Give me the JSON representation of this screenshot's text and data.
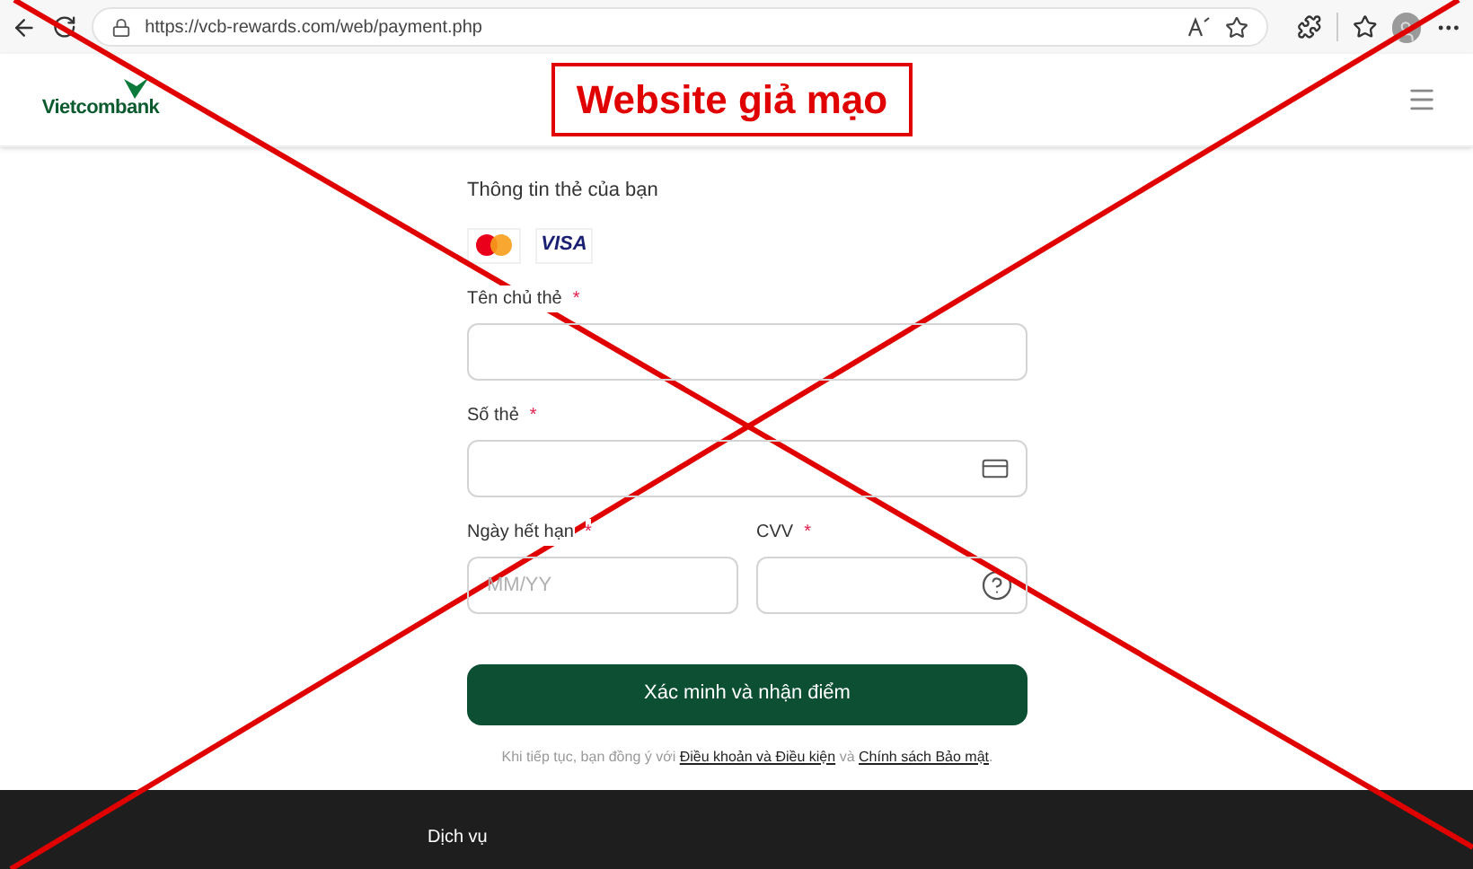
{
  "browser": {
    "url": "https://vcb-rewards.com/web/payment.php"
  },
  "header": {
    "logo": "Vietcombank",
    "warning_label": "Website giả mạo"
  },
  "form": {
    "title": "Thông tin thẻ của bạn",
    "visa_label": "VISA",
    "rows": [
      [
        {
          "label": "Tên chủ thẻ",
          "required_mark": "*",
          "kind": "text"
        }
      ],
      [
        {
          "label": "Số thẻ",
          "required_mark": "*",
          "kind": "card"
        }
      ],
      [
        {
          "label": "Ngày hết hạn",
          "required_mark": "*",
          "kind": "text",
          "placeholder": "MM/YY"
        },
        {
          "label": "CVV",
          "required_mark": "*",
          "kind": "help"
        }
      ]
    ],
    "submit": "Xác minh và nhận điểm",
    "terms": {
      "prefix": "Khi tiếp tục, bạn đồng ý với",
      "link_terms": "Điều khoản và Điều kiện",
      "middle": "và",
      "link_privacy": "Chính sách Bảo mật",
      "suffix": "."
    }
  },
  "footer": {
    "heading": "Dịch vụ"
  }
}
